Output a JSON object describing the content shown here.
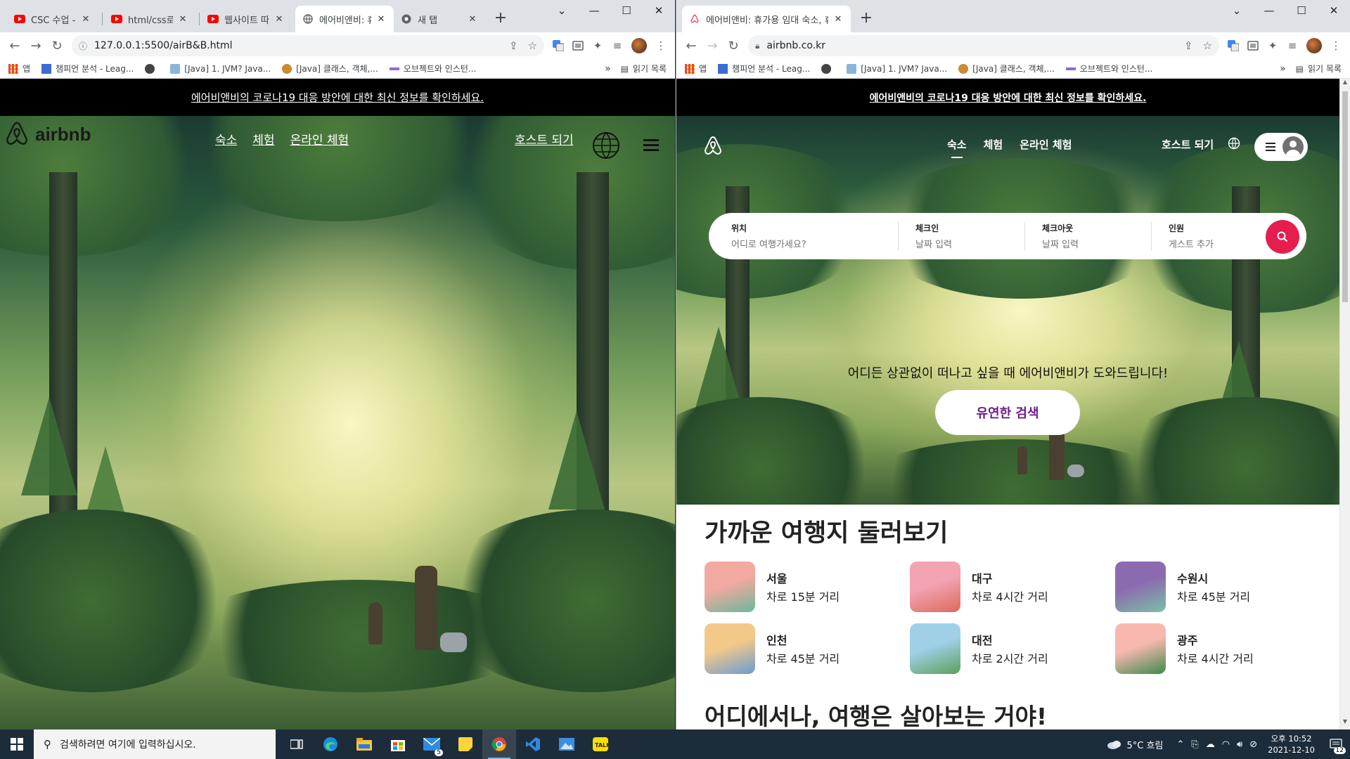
{
  "left_window": {
    "tabs": [
      {
        "title": "CSC 수업 - 바",
        "favicon": "youtube-icon"
      },
      {
        "title": "html/css로 블",
        "favicon": "youtube-icon"
      },
      {
        "title": "웹사이트 따라",
        "favicon": "youtube-icon"
      },
      {
        "title": "에어비앤비: 휴",
        "favicon": "globe-icon"
      },
      {
        "title": "새 탭",
        "favicon": "chrome-icon"
      }
    ],
    "url": "127.0.0.1:5500/airB&B.html",
    "page": {
      "covid_banner": "에어비앤비의 코로나19 대응 방안에 대한 최신 정보를 확인하세요.",
      "logo_text": "airbnb",
      "menu": [
        "숙소",
        "체험",
        "온라인 체험"
      ],
      "host_link": "호스트 되기"
    }
  },
  "right_window": {
    "tabs": [
      {
        "title": "에어비앤비: 휴가용 임대 숙소, 휴",
        "favicon": "airbnb-icon"
      }
    ],
    "url": "airbnb.co.kr",
    "page": {
      "covid_banner": "에어비앤비의 코로나19 대응 방안에 대한 최신 정보를 확인하세요.",
      "menu": [
        "숙소",
        "체험",
        "온라인 체험"
      ],
      "host_link": "호스트 되기",
      "search": {
        "location_label": "위치",
        "location_placeholder": "어디로 여행가세요?",
        "checkin_label": "체크인",
        "checkin_placeholder": "날짜 입력",
        "checkout_label": "체크아웃",
        "checkout_placeholder": "날짜 입력",
        "guests_label": "인원",
        "guests_placeholder": "게스트 추가"
      },
      "hero_text": "어디든 상관없이 떠나고 싶을 때 에어비앤비가 도와드립니다!",
      "flexible_button": "유연한 검색",
      "nearby_title": "가까운 여행지 둘러보기",
      "destinations": [
        {
          "name": "서울",
          "distance": "차로 15분 거리",
          "color_a": "#f2a9a0",
          "color_b": "#6cb89a"
        },
        {
          "name": "대구",
          "distance": "차로 4시간 거리",
          "color_a": "#f4a3b3",
          "color_b": "#d96b5a"
        },
        {
          "name": "수원시",
          "distance": "차로 45분 거리",
          "color_a": "#8b6bb0",
          "color_b": "#7cc0a4"
        },
        {
          "name": "인천",
          "distance": "차로 45분 거리",
          "color_a": "#f3c98a",
          "color_b": "#6a9bd0"
        },
        {
          "name": "대전",
          "distance": "차로 2시간 거리",
          "color_a": "#9fd0e8",
          "color_b": "#5aa05a"
        },
        {
          "name": "광주",
          "distance": "차로 4시간 거리",
          "color_a": "#f7b8b0",
          "color_b": "#3f8a4a"
        }
      ],
      "anywhere_title": "어디에서나, 여행은 살아보는 거야!"
    }
  },
  "bookmarks": [
    {
      "label": "앱",
      "icon": "apps-grid-icon"
    },
    {
      "label": "챔피언 분석 - Leag...",
      "icon": "bookmark-site-icon"
    },
    {
      "label": "",
      "icon": "globe-bookmark-icon"
    },
    {
      "label": "[Java] 1. JVM? Java...",
      "icon": "bookmark-site-icon"
    },
    {
      "label": "[Java] 클래스, 객체,...",
      "icon": "bookmark-site-icon"
    },
    {
      "label": "오브젝트와 인스턴...",
      "icon": "bookmark-site-icon"
    }
  ],
  "bookmarks_more": "»",
  "reading_list": "읽기 목록",
  "taskbar": {
    "search_placeholder": "검색하려면 여기에 입력하십시오.",
    "weather": "5°C 흐림",
    "time": "오후 10:52",
    "date": "2021-12-10",
    "notification_count": "12",
    "mail_badge": "5"
  }
}
